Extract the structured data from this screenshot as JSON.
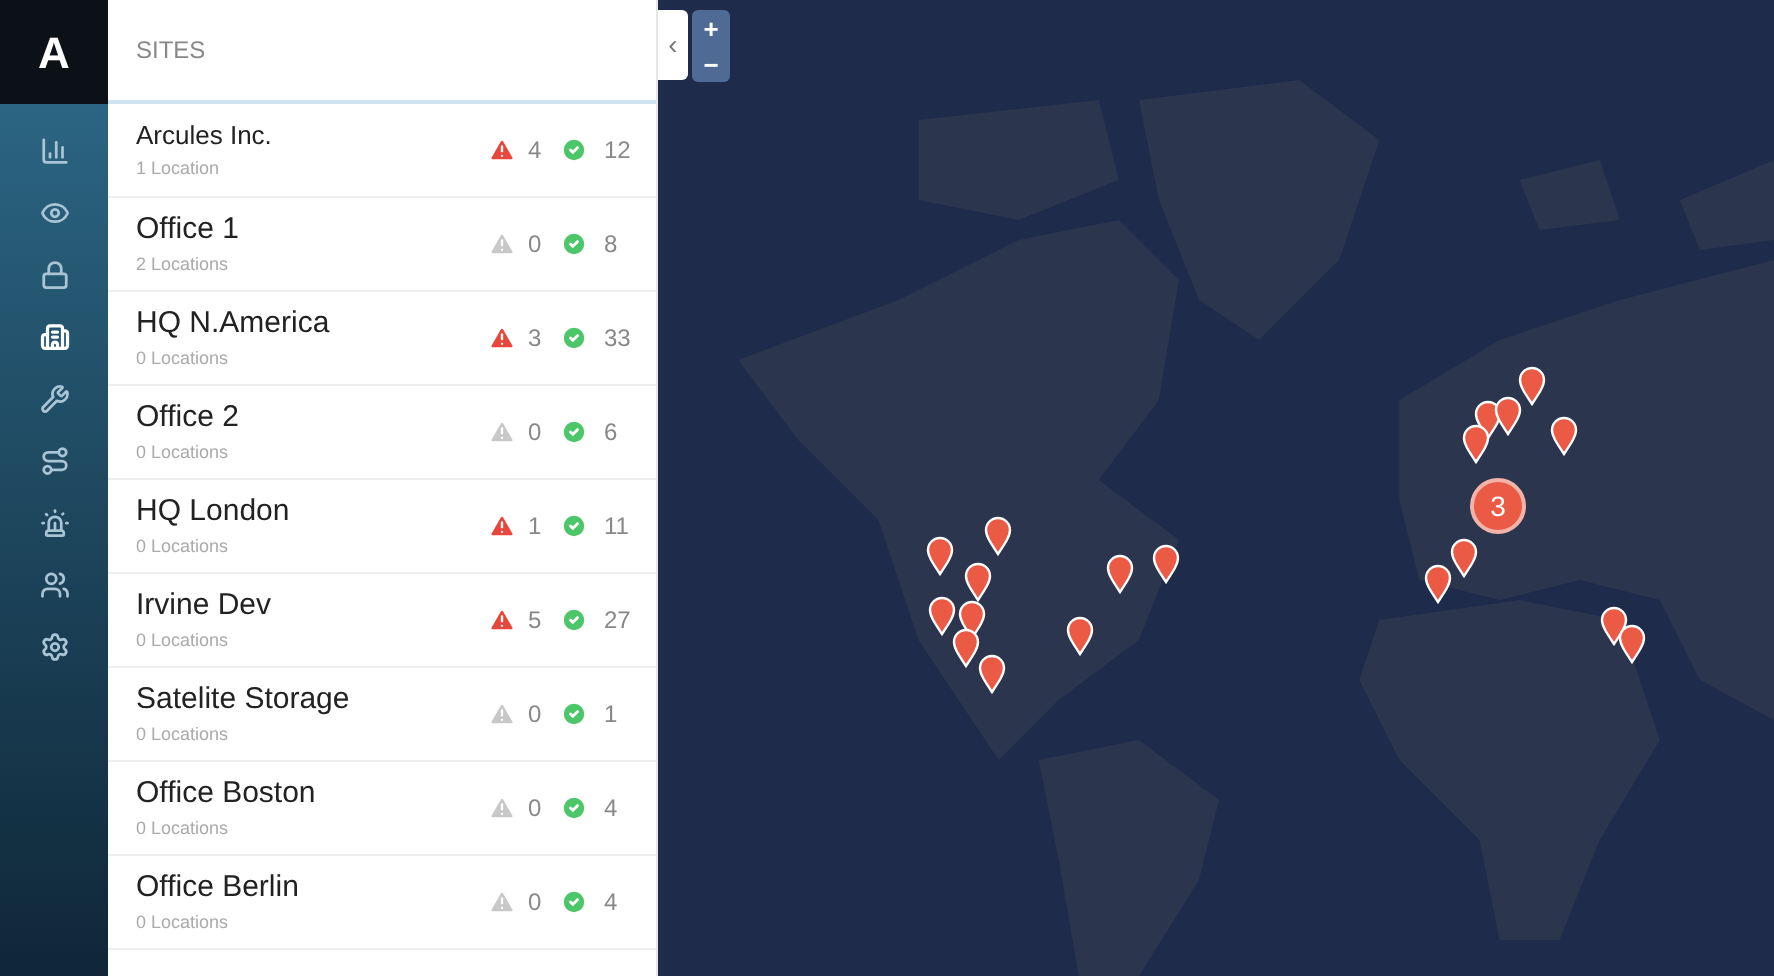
{
  "nav": {
    "logo": "A",
    "items": [
      {
        "selected": false
      },
      {
        "selected": false
      },
      {
        "selected": false
      },
      {
        "selected": true
      },
      {
        "selected": false
      },
      {
        "selected": false
      },
      {
        "selected": false
      },
      {
        "selected": false
      },
      {
        "selected": false
      }
    ]
  },
  "sites": {
    "title": "SITES",
    "rows": [
      {
        "name": "Arcules Inc.",
        "locations": "1 Location",
        "kind": "parent",
        "alerts": "4",
        "alert_active": true,
        "ok": "12"
      },
      {
        "name": "Office 1",
        "locations": "2 Locations",
        "kind": "site",
        "alerts": "0",
        "alert_active": false,
        "ok": "8"
      },
      {
        "name": "HQ N.America",
        "locations": "0 Locations",
        "kind": "site",
        "alerts": "3",
        "alert_active": true,
        "ok": "33"
      },
      {
        "name": "Office 2",
        "locations": "0 Locations",
        "kind": "site",
        "alerts": "0",
        "alert_active": false,
        "ok": "6"
      },
      {
        "name": "HQ London",
        "locations": "0 Locations",
        "kind": "site",
        "alerts": "1",
        "alert_active": true,
        "ok": "11"
      },
      {
        "name": "Irvine Dev",
        "locations": "0 Locations",
        "kind": "site",
        "alerts": "5",
        "alert_active": true,
        "ok": "27"
      },
      {
        "name": "Satelite Storage",
        "locations": "0 Locations",
        "kind": "site",
        "alerts": "0",
        "alert_active": false,
        "ok": "1"
      },
      {
        "name": "Office Boston",
        "locations": "0 Locations",
        "kind": "site",
        "alerts": "0",
        "alert_active": false,
        "ok": "4"
      },
      {
        "name": "Office Berlin",
        "locations": "0 Locations",
        "kind": "site",
        "alerts": "0",
        "alert_active": false,
        "ok": "4"
      }
    ]
  },
  "map": {
    "collapse": "‹",
    "zoom_in": "+",
    "zoom_out": "−",
    "markers": [
      {
        "kind": "pin"
      },
      {
        "kind": "pin"
      },
      {
        "kind": "pin"
      },
      {
        "kind": "pin"
      },
      {
        "kind": "pin"
      },
      {
        "kind": "pin"
      },
      {
        "kind": "pin"
      },
      {
        "kind": "pin"
      },
      {
        "kind": "pin"
      },
      {
        "kind": "pin"
      },
      {
        "kind": "pin"
      },
      {
        "kind": "pin"
      },
      {
        "kind": "pin"
      },
      {
        "kind": "pin"
      },
      {
        "kind": "pin"
      },
      {
        "kind": "pin"
      },
      {
        "kind": "pin"
      },
      {
        "kind": "pin"
      },
      {
        "kind": "pin"
      },
      {
        "kind": "cluster",
        "count": "3"
      }
    ]
  }
}
